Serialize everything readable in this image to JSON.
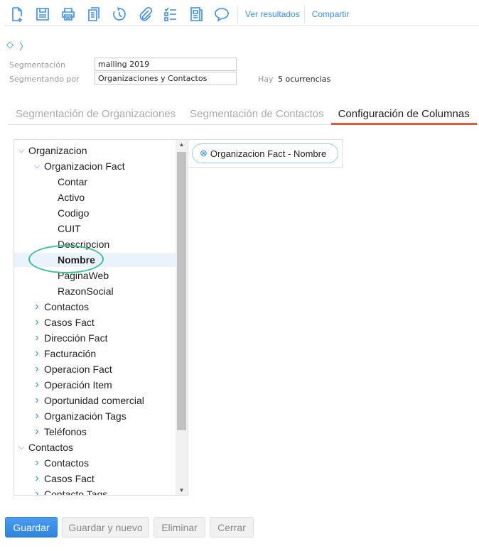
{
  "toolbar": {
    "icons": [
      "new-document-icon",
      "save-icon",
      "print-icon",
      "copy-icon",
      "history-icon",
      "attachment-icon",
      "checklist-icon",
      "notes-icon",
      "comment-icon"
    ],
    "ver_resultados": "Ver resultados",
    "compartir": "Compartir"
  },
  "form": {
    "segmentacion_label": "Segmentación",
    "segmentacion_value": "mailing 2019",
    "segmentando_label": "Segmentando por",
    "segmentando_value": "Organizaciones y Contactos",
    "hay_label": "Hay",
    "ocurrencias": "5 ocurrencias"
  },
  "tabs": [
    "Segmentación de Organizaciones",
    "Segmentación de Contactos",
    "Configuración de Columnas"
  ],
  "tree": [
    {
      "label": "Organizacion",
      "level": 0,
      "state": "open"
    },
    {
      "label": "Organizacion Fact",
      "level": 1,
      "state": "open"
    },
    {
      "label": "Contar",
      "level": 2,
      "state": "leaf"
    },
    {
      "label": "Activo",
      "level": 2,
      "state": "leaf"
    },
    {
      "label": "Codigo",
      "level": 2,
      "state": "leaf"
    },
    {
      "label": "CUIT",
      "level": 2,
      "state": "leaf"
    },
    {
      "label": "Descripcion",
      "level": 2,
      "state": "leaf"
    },
    {
      "label": "Nombre",
      "level": 2,
      "state": "leaf",
      "selected": true
    },
    {
      "label": "PaginaWeb",
      "level": 2,
      "state": "leaf"
    },
    {
      "label": "RazonSocial",
      "level": 2,
      "state": "leaf"
    },
    {
      "label": "Contactos",
      "level": 1,
      "state": "closed"
    },
    {
      "label": "Casos Fact",
      "level": 1,
      "state": "closed"
    },
    {
      "label": "Dirección Fact",
      "level": 1,
      "state": "closed"
    },
    {
      "label": "Facturación",
      "level": 1,
      "state": "closed"
    },
    {
      "label": "Operacion Fact",
      "level": 1,
      "state": "closed"
    },
    {
      "label": "Operación Item",
      "level": 1,
      "state": "closed"
    },
    {
      "label": "Oportunidad comercial",
      "level": 1,
      "state": "closed"
    },
    {
      "label": "Organización Tags",
      "level": 1,
      "state": "closed"
    },
    {
      "label": "Teléfonos",
      "level": 1,
      "state": "closed"
    },
    {
      "label": "Contactos",
      "level": 0,
      "state": "open"
    },
    {
      "label": "Contactos",
      "level": 1,
      "state": "closed"
    },
    {
      "label": "Casos Fact",
      "level": 1,
      "state": "closed"
    },
    {
      "label": "Contacto Tags",
      "level": 1,
      "state": "closed"
    }
  ],
  "columns": [
    {
      "label": "Organizacion Fact - Nombre"
    }
  ],
  "buttons": {
    "guardar": "Guardar",
    "guardar_nuevo": "Guardar y nuevo",
    "eliminar": "Eliminar",
    "cerrar": "Cerrar"
  }
}
